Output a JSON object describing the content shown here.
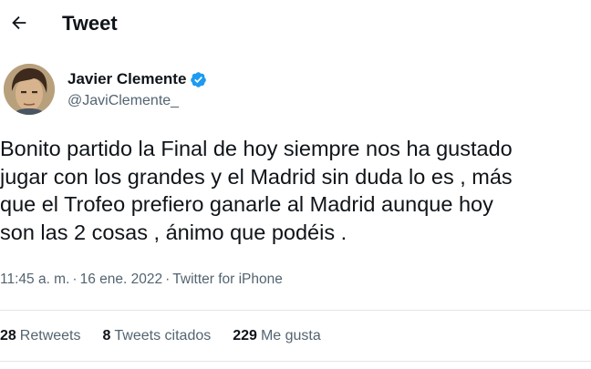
{
  "header": {
    "back_icon": "arrow-left-icon",
    "title": "Tweet"
  },
  "author": {
    "display_name": "Javier Clemente",
    "verified_icon": "verified-badge-icon",
    "verified_color": "#1d9bf0",
    "handle": "@JaviClemente_"
  },
  "tweet": {
    "text": "Bonito partido la Final de hoy siempre nos ha gustado\njugar con los grandes y el Madrid sin duda lo es , más\nque el Trofeo prefiero ganarle al Madrid aunque hoy\nson las 2 cosas , ánimo que podéis ."
  },
  "meta": {
    "time": "11:45 a. m.",
    "separator": "·",
    "date": "16 ene. 2022",
    "source": "Twitter for iPhone"
  },
  "stats": {
    "retweets_count": "28",
    "retweets_label": "Retweets",
    "quotes_count": "8",
    "quotes_label": "Tweets citados",
    "likes_count": "229",
    "likes_label": "Me gusta"
  },
  "colors": {
    "text_primary": "#0f1419",
    "text_secondary": "#536471",
    "divider": "#e1e6ea"
  }
}
